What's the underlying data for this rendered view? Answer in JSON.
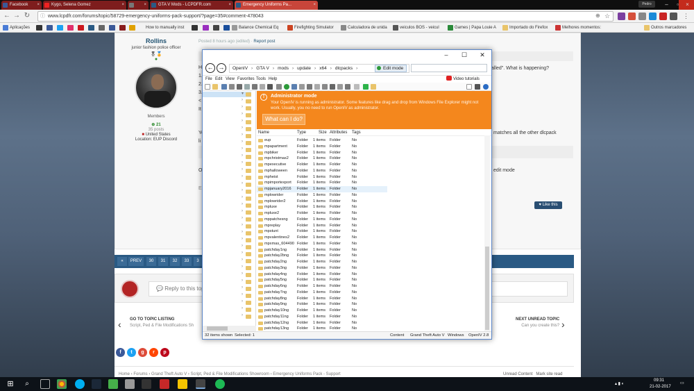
{
  "browser": {
    "tabs": [
      {
        "label": "Facebook"
      },
      {
        "label": "Kygo, Selena Gomez"
      },
      {
        "label": ""
      },
      {
        "label": "GTA V Mods - LCPDFR.com"
      },
      {
        "label": "Emergency Uniforms Pa..."
      }
    ],
    "user": "Pedro",
    "url": "www.lcpdfr.com/forums/topic/58729-emergency-uniforms-pack-support/?page=35#comment-478043",
    "bookmarks": [
      {
        "label": "Aplicações"
      },
      {
        "label": "How to manually inst"
      },
      {
        "label": "Balance Chemical Eq"
      },
      {
        "label": "Firefighting Simulator"
      },
      {
        "label": "Calculadora de unida"
      },
      {
        "label": "veiculos BOS - veicul"
      },
      {
        "label": "Games | Papa Louie A"
      },
      {
        "label": "Importado do Firefox"
      },
      {
        "label": "Melhores momentos:"
      }
    ],
    "other_bookmarks": "Outros marcadores"
  },
  "post": {
    "author": "Rollins",
    "author_title": "junior fashion police officer",
    "group": "Members",
    "reputation": "21",
    "posts": "35 posts",
    "country": "United States",
    "location": "Location: EUP Discord",
    "meta_posted": "Posted 8 hours ago (edited)",
    "meta_report": "Report post",
    "line_h": "H",
    "line_1": "1.",
    "line_2": "2.",
    "line_3": "3.",
    "line_lt": "<",
    "line_it": "It",
    "frag_called": "alled\". What is happening?",
    "line_yo": "Yo",
    "frag_matches": "matches all the other dlcpack",
    "line_li": "li",
    "line_o": "O",
    "frag_edit": "edit mode",
    "line_ec": "Ec",
    "like": "Like this"
  },
  "pager": {
    "prev": "PREV",
    "pages": [
      "30",
      "31",
      "32",
      "33",
      "3"
    ]
  },
  "reply": {
    "placeholder": "Reply to this topi"
  },
  "topic_nav": {
    "left_title": "GO TO TOPIC LISTING",
    "left_sub": "Script, Ped & File Modifications Sh",
    "right_title": "NEXT UNREAD TOPIC",
    "right_sub": "Can you create this?"
  },
  "footer": {
    "breadcrumb": "Home  ›  Forums  ›  Grand Theft Auto V  ›  Script, Ped & File Modifications Showroom  ›  Emergency Uniforms Pack - Support",
    "unread": "Unread Content",
    "mark_read": "Mark site read"
  },
  "openiv": {
    "path": [
      "OpenIV",
      "GTA V",
      "mods",
      "update",
      "x64",
      "dlcpacks"
    ],
    "edit_mode": "Edit mode",
    "menu": [
      "File",
      "Edit",
      "View",
      "Favorites",
      "Tools",
      "Help"
    ],
    "video_tutorials": "Video tutorials",
    "admin_title": "Administrator mode",
    "admin_msg": "Your OpenIV is running as administrator. Some features like drag and drop from Windows File Explorer might not work. Usually, you no need to run OpenIV as administrator.",
    "admin_button": "What can I do?",
    "columns": [
      "Name",
      "Type",
      "Size",
      "Attributes",
      "Tags"
    ],
    "rows": [
      {
        "name": "eup",
        "type": "Folder",
        "size": "1 items",
        "attr": "Folder",
        "tags": "No"
      },
      {
        "name": "mpapartment",
        "type": "Folder",
        "size": "1 items",
        "attr": "Folder",
        "tags": "No"
      },
      {
        "name": "mpbiker",
        "type": "Folder",
        "size": "1 items",
        "attr": "Folder",
        "tags": "No"
      },
      {
        "name": "mpchristmas2",
        "type": "Folder",
        "size": "1 items",
        "attr": "Folder",
        "tags": "No"
      },
      {
        "name": "mpexecutive",
        "type": "Folder",
        "size": "1 items",
        "attr": "Folder",
        "tags": "No"
      },
      {
        "name": "mphalloween",
        "type": "Folder",
        "size": "1 items",
        "attr": "Folder",
        "tags": "No"
      },
      {
        "name": "mpheist",
        "type": "Folder",
        "size": "1 items",
        "attr": "Folder",
        "tags": "No"
      },
      {
        "name": "mpimportexport",
        "type": "Folder",
        "size": "1 items",
        "attr": "Folder",
        "tags": "No"
      },
      {
        "name": "mpjanuary2016",
        "type": "Folder",
        "size": "1 items",
        "attr": "Folder",
        "tags": "No"
      },
      {
        "name": "mplowrider",
        "type": "Folder",
        "size": "1 items",
        "attr": "Folder",
        "tags": "No"
      },
      {
        "name": "mplowrider2",
        "type": "Folder",
        "size": "1 items",
        "attr": "Folder",
        "tags": "No"
      },
      {
        "name": "mpluxe",
        "type": "Folder",
        "size": "1 items",
        "attr": "Folder",
        "tags": "No"
      },
      {
        "name": "mpluxe2",
        "type": "Folder",
        "size": "1 items",
        "attr": "Folder",
        "tags": "No"
      },
      {
        "name": "mppatchesng",
        "type": "Folder",
        "size": "1 items",
        "attr": "Folder",
        "tags": "No"
      },
      {
        "name": "mpreplay",
        "type": "Folder",
        "size": "1 items",
        "attr": "Folder",
        "tags": "No"
      },
      {
        "name": "mpstunt",
        "type": "Folder",
        "size": "1 items",
        "attr": "Folder",
        "tags": "No"
      },
      {
        "name": "mpvalentines2",
        "type": "Folder",
        "size": "1 items",
        "attr": "Folder",
        "tags": "No"
      },
      {
        "name": "mpxmas_604490",
        "type": "Folder",
        "size": "1 items",
        "attr": "Folder",
        "tags": "No"
      },
      {
        "name": "patchday1ng",
        "type": "Folder",
        "size": "1 items",
        "attr": "Folder",
        "tags": "No"
      },
      {
        "name": "patchday2bng",
        "type": "Folder",
        "size": "1 items",
        "attr": "Folder",
        "tags": "No"
      },
      {
        "name": "patchday2ng",
        "type": "Folder",
        "size": "1 items",
        "attr": "Folder",
        "tags": "No"
      },
      {
        "name": "patchday3ng",
        "type": "Folder",
        "size": "1 items",
        "attr": "Folder",
        "tags": "No"
      },
      {
        "name": "patchday4ng",
        "type": "Folder",
        "size": "1 items",
        "attr": "Folder",
        "tags": "No"
      },
      {
        "name": "patchday5ng",
        "type": "Folder",
        "size": "1 items",
        "attr": "Folder",
        "tags": "No"
      },
      {
        "name": "patchday6ng",
        "type": "Folder",
        "size": "1 items",
        "attr": "Folder",
        "tags": "No"
      },
      {
        "name": "patchday7ng",
        "type": "Folder",
        "size": "1 items",
        "attr": "Folder",
        "tags": "No"
      },
      {
        "name": "patchday8ng",
        "type": "Folder",
        "size": "1 items",
        "attr": "Folder",
        "tags": "No"
      },
      {
        "name": "patchday9ng",
        "type": "Folder",
        "size": "1 items",
        "attr": "Folder",
        "tags": "No"
      },
      {
        "name": "patchday10ng",
        "type": "Folder",
        "size": "1 items",
        "attr": "Folder",
        "tags": "No"
      },
      {
        "name": "patchday11ng",
        "type": "Folder",
        "size": "1 items",
        "attr": "Folder",
        "tags": "No"
      },
      {
        "name": "patchday12ng",
        "type": "Folder",
        "size": "1 items",
        "attr": "Folder",
        "tags": "No"
      },
      {
        "name": "patchday13ng",
        "type": "Folder",
        "size": "1 items",
        "attr": "Folder",
        "tags": "No"
      }
    ],
    "status": {
      "shown": "32 items shown",
      "selected": "Selected: 1",
      "content": "Content",
      "game": "Grand Theft Auto V",
      "platform": "Windows",
      "version": "OpenIV 2.8"
    }
  },
  "taskbar": {
    "time": "09:31",
    "date": "21-02-2017"
  }
}
